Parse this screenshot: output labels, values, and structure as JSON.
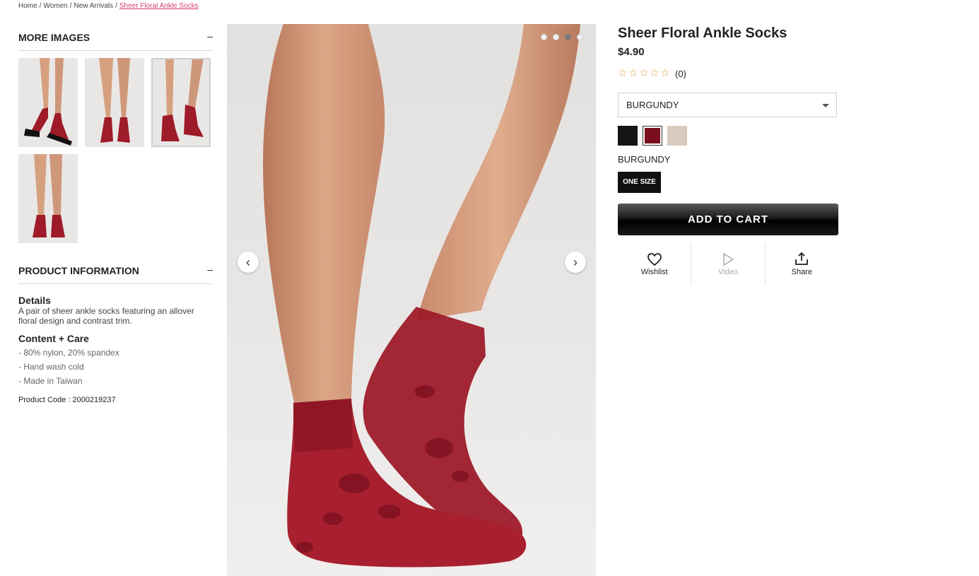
{
  "breadcrumb": {
    "home": "Home",
    "women": "Women",
    "new_arrivals": "New Arrivals",
    "current": "Sheer Floral Ankle Socks",
    "separator": "/"
  },
  "more_images": {
    "title": "MORE IMAGES",
    "toggle": "–"
  },
  "product_info": {
    "title": "PRODUCT INFORMATION",
    "toggle": "–",
    "details_title": "Details",
    "details_text": "A pair of sheer ankle socks featuring an allover floral design and contrast trim.",
    "care_title": "Content + Care",
    "care_items": [
      "- 80% nylon, 20% spandex",
      "- Hand wash cold",
      "- Made in Taiwan"
    ],
    "product_code": "Product Code : 2000219237"
  },
  "carousel": {
    "prev": "‹",
    "next": "›",
    "dot_count": 4,
    "active_dot": 3
  },
  "product": {
    "title": "Sheer Floral Ankle Socks",
    "price": "$4.90",
    "stars": "☆",
    "star_count": 5,
    "rating_count": "(0)",
    "color_select": "BURGUNDY",
    "color_name": "BURGUNDY",
    "size": "ONE SIZE",
    "add_to_cart": "ADD TO CART"
  },
  "swatches": [
    {
      "name": "black",
      "color": "#141414"
    },
    {
      "name": "burgundy",
      "color": "#7a0f1f",
      "selected": true
    },
    {
      "name": "nude",
      "color": "#d9ccbf"
    }
  ],
  "actions": {
    "wishlist": "Wishlist",
    "video": "Video",
    "share": "Share"
  },
  "colors": {
    "link_pink": "#d43c7a",
    "sock_red": "#9e1b2a",
    "skin": "#d49a7a",
    "star": "#d9a441"
  }
}
